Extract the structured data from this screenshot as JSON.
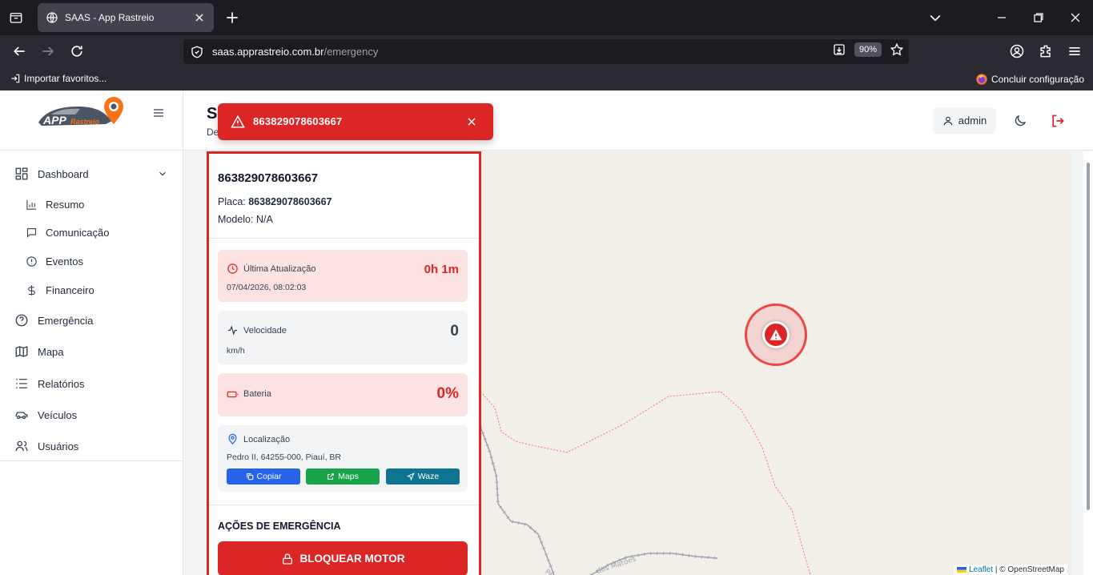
{
  "browser": {
    "tab_title": "SAAS - App Rastreio",
    "url_domain": "saas.apprastreio.com.br",
    "url_path": "/emergency",
    "zoom": "90%",
    "bookmark_import": "Importar favoritos...",
    "bookmark_setup": "Concluir configuração"
  },
  "sidebar": {
    "logo_text": "APP Rastreio",
    "items": [
      {
        "label": "Dashboard",
        "icon": "dashboard-icon"
      },
      {
        "label": "Resumo",
        "icon": "bar-chart-icon"
      },
      {
        "label": "Comunicação",
        "icon": "message-icon"
      },
      {
        "label": "Eventos",
        "icon": "alert-circle-icon"
      },
      {
        "label": "Financeiro",
        "icon": "dollar-icon"
      },
      {
        "label": "Emergência",
        "icon": "help-circle-icon"
      },
      {
        "label": "Mapa",
        "icon": "map-icon"
      },
      {
        "label": "Relatórios",
        "icon": "list-icon"
      },
      {
        "label": "Veículos",
        "icon": "car-icon"
      },
      {
        "label": "Usuários",
        "icon": "users-icon"
      }
    ]
  },
  "header": {
    "title": "S",
    "subtitle": "De",
    "user": "admin"
  },
  "toast": {
    "message": "863829078603667"
  },
  "panel": {
    "device_id": "863829078603667",
    "placa_label": "Placa:",
    "placa_value": "863829078603667",
    "modelo": "Modelo: N/A",
    "last_update": {
      "label": "Última Atualização",
      "value": "0h 1m",
      "date": "07/04/2026, 08:02:03"
    },
    "speed": {
      "label": "Velocidade",
      "value": "0",
      "unit": "km/h"
    },
    "battery": {
      "label": "Bateria",
      "value": "0%"
    },
    "location": {
      "label": "Localização",
      "address": "Pedro II, 64255-000, Piauí, BR",
      "btn_copy": "Copiar",
      "btn_maps": "Maps",
      "btn_waze": "Waze"
    },
    "actions_title": "AÇÕES DE EMERGÊNCIA",
    "block_button": "BLOQUEAR MOTOR"
  },
  "map": {
    "attribution_leaflet": "Leaflet",
    "attribution_rest": "| © OpenStreetMap",
    "road_labels": [
      "Pedro",
      "dos Matões"
    ]
  },
  "colors": {
    "primary_red": "#dc2626",
    "blue": "#2563eb",
    "green": "#16a34a",
    "cyan": "#0e7490"
  }
}
